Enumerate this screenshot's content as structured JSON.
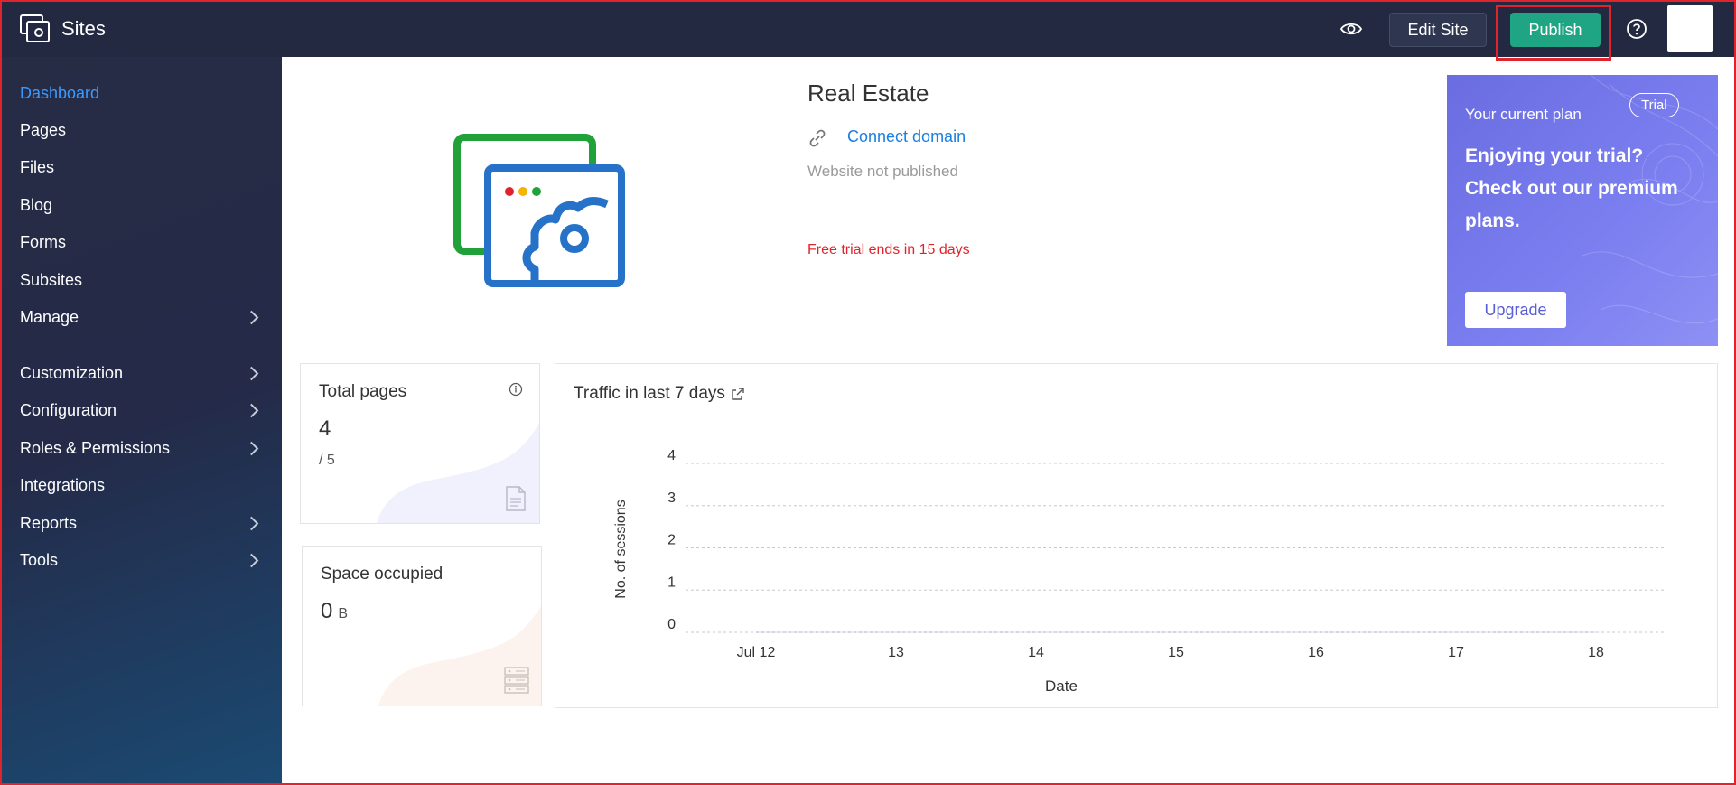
{
  "header": {
    "app_name": "Sites",
    "edit_label": "Edit Site",
    "publish_label": "Publish"
  },
  "sidebar": {
    "items": [
      {
        "label": "Dashboard",
        "active": true
      },
      {
        "label": "Pages"
      },
      {
        "label": "Files"
      },
      {
        "label": "Blog"
      },
      {
        "label": "Forms"
      },
      {
        "label": "Subsites"
      },
      {
        "label": "Manage",
        "has_children": true
      },
      {
        "label": "Customization",
        "has_children": true
      },
      {
        "label": "Configuration",
        "has_children": true
      },
      {
        "label": "Roles & Permissions",
        "has_children": true
      },
      {
        "label": "Integrations"
      },
      {
        "label": "Reports",
        "has_children": true
      },
      {
        "label": "Tools",
        "has_children": true
      }
    ]
  },
  "site": {
    "name": "Real Estate",
    "connect_label": "Connect domain",
    "status": "Website not published",
    "trial_notice": "Free trial ends in 15 days"
  },
  "plan": {
    "label": "Your current plan",
    "badge": "Trial",
    "message": "Enjoying your trial? Check out our premium plans.",
    "upgrade_label": "Upgrade"
  },
  "stats": {
    "pages": {
      "title": "Total pages",
      "value": "4",
      "limit": "/ 5"
    },
    "space": {
      "title": "Space occupied",
      "value": "0",
      "unit": "B"
    }
  },
  "traffic": {
    "title": "Traffic in last 7 days"
  },
  "chart_data": {
    "type": "line",
    "title": "Traffic in last 7 days",
    "xlabel": "Date",
    "ylabel": "No. of sessions",
    "categories": [
      "Jul 12",
      "13",
      "14",
      "15",
      "16",
      "17",
      "18"
    ],
    "y_ticks": [
      "0",
      "1",
      "2",
      "3",
      "4"
    ],
    "ylim": [
      0,
      4
    ],
    "series": [
      {
        "values": [
          0,
          0,
          0,
          0,
          0,
          0,
          0
        ]
      }
    ],
    "grid": true
  },
  "colors": {
    "topbar": "#232941",
    "publish": "#1fa583",
    "link": "#1a7fe0",
    "alert": "#e0242c",
    "plan": "#7b7ff0"
  }
}
